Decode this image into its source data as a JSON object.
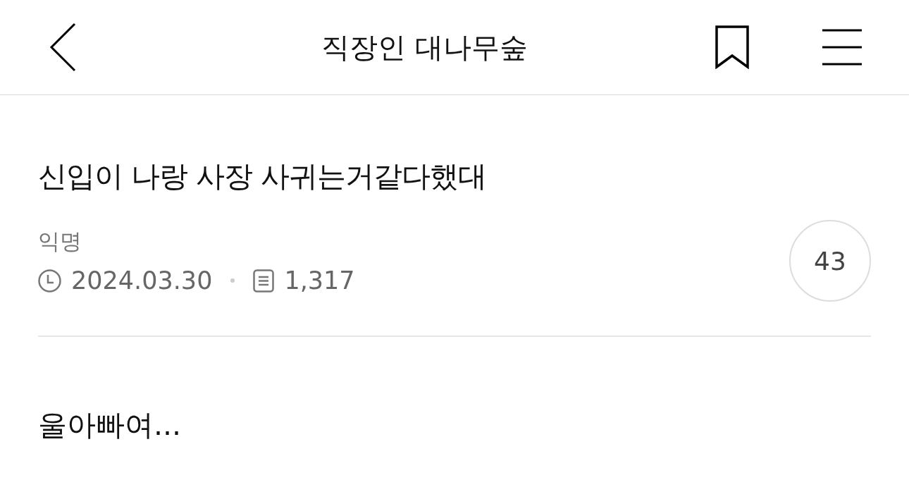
{
  "header": {
    "title": "직장인 대나무숲",
    "bookmarked": false
  },
  "post": {
    "title": "신입이 나랑 사장 사귀는거같다했대",
    "author": "익명",
    "date": "2024.03.30",
    "views": "1,317",
    "comment_count": "43",
    "body": "울아빠여..."
  }
}
